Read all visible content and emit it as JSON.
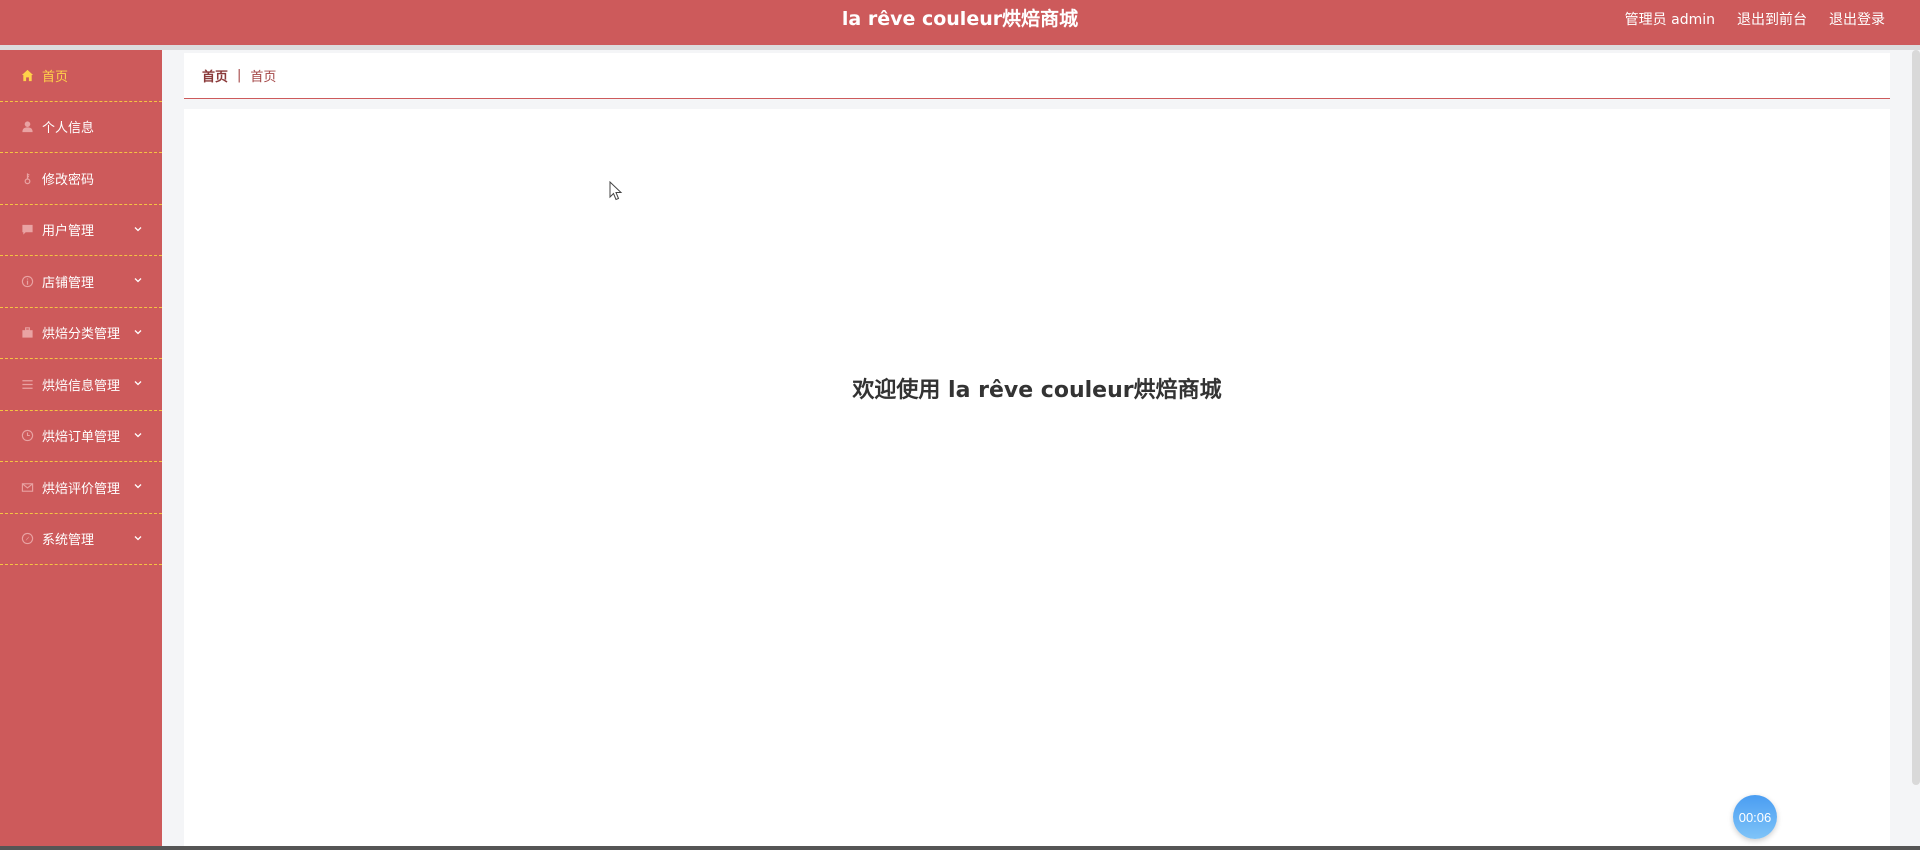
{
  "header": {
    "title": "la rêve couleur烘焙商城",
    "user_label": "管理员 admin",
    "front_label": "退出到前台",
    "logout_label": "退出登录",
    "color": "#cd5a5b"
  },
  "sidebar": {
    "items": [
      {
        "label": "首页",
        "icon": "home-icon",
        "active": true
      },
      {
        "label": "个人信息",
        "icon": "user-icon"
      },
      {
        "label": "修改密码",
        "icon": "key-icon"
      },
      {
        "label": "用户管理",
        "icon": "chat-icon",
        "expandable": true
      },
      {
        "label": "店铺管理",
        "icon": "info-icon",
        "expandable": true
      },
      {
        "label": "烘焙分类管理",
        "icon": "briefcase-icon",
        "expandable": true
      },
      {
        "label": "烘焙信息管理",
        "icon": "list-icon",
        "expandable": true
      },
      {
        "label": "烘焙订单管理",
        "icon": "clock-icon",
        "expandable": true
      },
      {
        "label": "烘焙评价管理",
        "icon": "mail-icon",
        "expandable": true
      },
      {
        "label": "系统管理",
        "icon": "compass-icon",
        "expandable": true
      }
    ],
    "active_color": "#ffd24a",
    "divider_color": "#f5c342"
  },
  "breadcrumb": {
    "home": "首页",
    "separator": "|",
    "current": "首页"
  },
  "main": {
    "welcome": "欢迎使用 la rêve couleur烘焙商城"
  },
  "timer": {
    "value": "00:06"
  }
}
